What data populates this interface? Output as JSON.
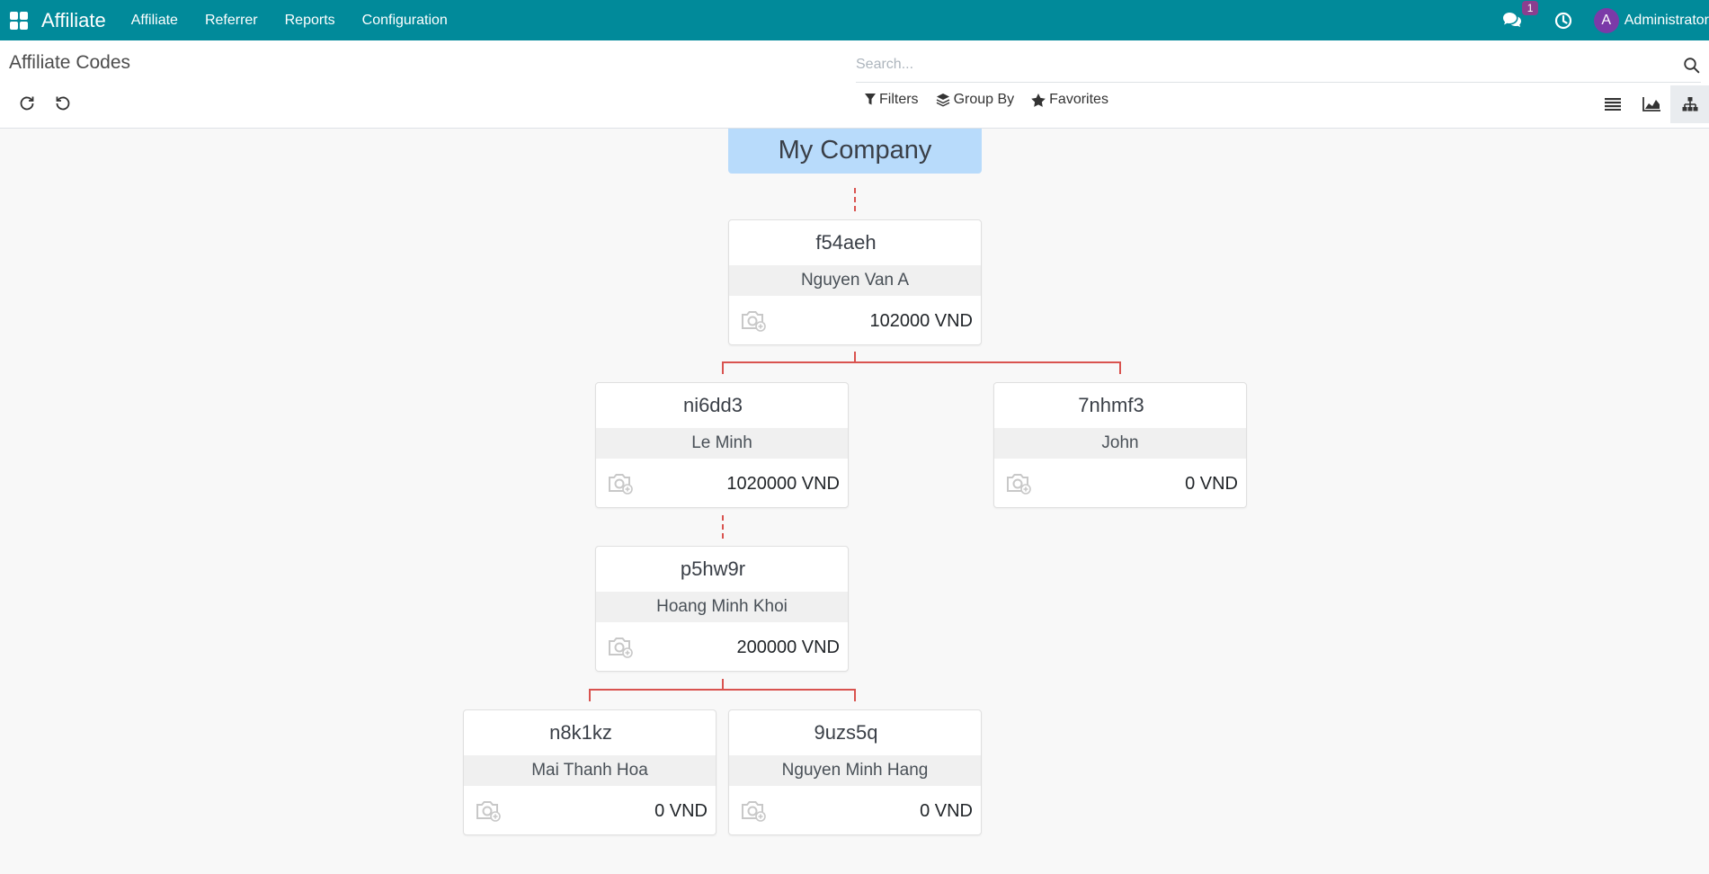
{
  "navbar": {
    "app_name": "Affiliate",
    "menu": [
      "Affiliate",
      "Referrer",
      "Reports",
      "Configuration"
    ],
    "chat_badge": "1",
    "user_initial": "A",
    "user_name": "Administrator"
  },
  "control_panel": {
    "title": "Affiliate Codes",
    "search_placeholder": "Search...",
    "filters_label": "Filters",
    "group_by_label": "Group By",
    "favorites_label": "Favorites"
  },
  "org_chart": {
    "root": "My Company",
    "nodes": [
      {
        "code": "f54aeh",
        "name": "Nguyen Van A",
        "amount": "102000 VND"
      },
      {
        "code": "ni6dd3",
        "name": "Le Minh",
        "amount": "1020000 VND"
      },
      {
        "code": "7nhmf3",
        "name": "John",
        "amount": "0 VND"
      },
      {
        "code": "p5hw9r",
        "name": "Hoang Minh Khoi",
        "amount": "200000 VND"
      },
      {
        "code": "n8k1kz",
        "name": "Mai Thanh Hoa",
        "amount": "0 VND"
      },
      {
        "code": "9uzs5q",
        "name": "Nguyen Minh Hang",
        "amount": "0 VND"
      }
    ]
  },
  "colors": {
    "navbar": "#018a9a",
    "root_node": "#b8dbfb",
    "connector": "#d9534f",
    "badge": "#8a3f8f",
    "avatar": "#7b3aa8"
  }
}
